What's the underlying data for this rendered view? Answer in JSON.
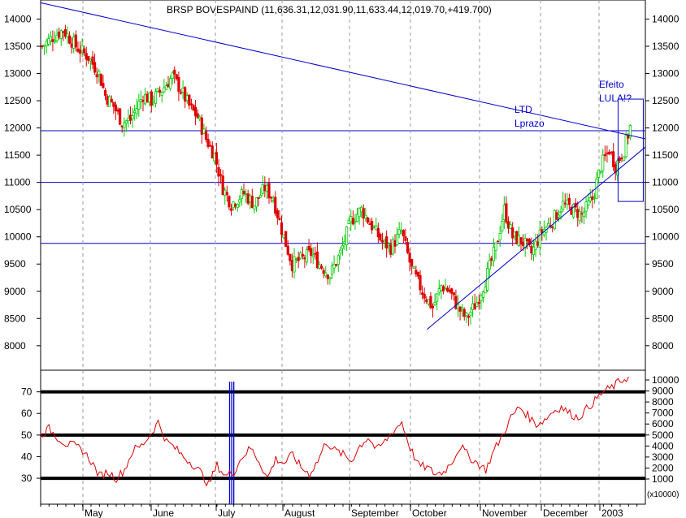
{
  "chart_data": [
    {
      "type": "candlestick",
      "title": "BRSP BOVESPAIND (11,636.31,12,031.90,11,633.44,12,019.70,+419.700)",
      "y_ticks": [
        8000,
        8500,
        9000,
        9500,
        10000,
        10500,
        11000,
        11500,
        12000,
        12500,
        13000,
        13500,
        14000
      ],
      "y_tick_labels": [
        "8000",
        "8500",
        "9000",
        "9500",
        "10000",
        "10500",
        "11000",
        "11500",
        "12000",
        "12500",
        "13000",
        "13500",
        "14000"
      ],
      "ylim": [
        7550,
        14350
      ],
      "x_month_labels": [
        "May",
        "June",
        "July",
        "August",
        "September",
        "October",
        "November",
        "December",
        "2003"
      ],
      "price_path": [
        [
          0,
          13500
        ],
        [
          6,
          13700
        ],
        [
          10,
          13800
        ],
        [
          16,
          13500
        ],
        [
          22,
          13300
        ],
        [
          27,
          13000
        ],
        [
          30,
          12600
        ],
        [
          34,
          12400
        ],
        [
          38,
          12100
        ],
        [
          42,
          12150
        ],
        [
          48,
          12600
        ],
        [
          52,
          12500
        ],
        [
          57,
          12700
        ],
        [
          62,
          12950
        ],
        [
          66,
          12700
        ],
        [
          70,
          12400
        ],
        [
          74,
          12200
        ],
        [
          78,
          11800
        ],
        [
          82,
          11500
        ],
        [
          86,
          10900
        ],
        [
          90,
          10600
        ],
        [
          96,
          10800
        ],
        [
          101,
          10600
        ],
        [
          106,
          10900
        ],
        [
          110,
          10700
        ],
        [
          115,
          10000
        ],
        [
          119,
          9500
        ],
        [
          124,
          9600
        ],
        [
          128,
          9700
        ],
        [
          132,
          9500
        ],
        [
          137,
          9300
        ],
        [
          142,
          9700
        ],
        [
          147,
          10300
        ],
        [
          152,
          10500
        ],
        [
          157,
          10200
        ],
        [
          162,
          9900
        ],
        [
          166,
          9800
        ],
        [
          171,
          10100
        ],
        [
          176,
          9400
        ],
        [
          181,
          9000
        ],
        [
          186,
          8700
        ],
        [
          190,
          9100
        ],
        [
          194,
          9000
        ],
        [
          198,
          8700
        ],
        [
          202,
          8500
        ],
        [
          207,
          8800
        ],
        [
          211,
          9200
        ],
        [
          216,
          9800
        ],
        [
          220,
          10500
        ],
        [
          224,
          10000
        ],
        [
          229,
          9900
        ],
        [
          233,
          9700
        ],
        [
          238,
          10100
        ],
        [
          243,
          10300
        ],
        [
          248,
          10600
        ],
        [
          253,
          10500
        ],
        [
          257,
          10400
        ],
        [
          262,
          10700
        ],
        [
          266,
          11300
        ],
        [
          270,
          11600
        ],
        [
          273,
          11300
        ],
        [
          277,
          11600
        ],
        [
          280,
          12019.7
        ]
      ],
      "highs_lows": [
        {
          "x": 0,
          "high": 13700,
          "low": 13350
        },
        {
          "x": 6,
          "high": 13900,
          "low": 13500
        },
        {
          "x": 10,
          "high": 13950,
          "low": 13600
        }
      ],
      "trend_lines": [
        {
          "label": "LTD Lprazo",
          "x1": 0,
          "y1": 14300,
          "x2": 288,
          "y2": 11800
        },
        {
          "label": "",
          "x1": 184,
          "y1": 8300,
          "x2": 288,
          "y2": 11650
        }
      ],
      "horizontal_lines": [
        11950,
        11000,
        9880
      ],
      "annotations": [
        {
          "text_lines": [
            "LTD",
            "Lprazo"
          ]
        },
        {
          "text_lines": [
            "Efeito",
            "LULA!?"
          ]
        }
      ],
      "box": {
        "x1": 275,
        "x2": 287,
        "y1": 10650,
        "y2": 12530
      }
    },
    {
      "type": "line",
      "name": "oscillator",
      "y_ticks_left": [
        30,
        40,
        50,
        60,
        70
      ],
      "y_tick_labels_left": [
        "30",
        "40",
        "50",
        "60",
        "70"
      ],
      "ylim_left": [
        18,
        80
      ],
      "y_ticks_right": [
        1000,
        2000,
        3000,
        4000,
        5000,
        6000,
        7000,
        8000,
        9000,
        10000
      ],
      "y_tick_labels_right": [
        "1000",
        "2000",
        "3000",
        "4000",
        "5000",
        "6000",
        "7000",
        "8000",
        "9000",
        "10000"
      ],
      "right_unit": "x10000",
      "reference_lines": [
        70,
        50,
        30
      ],
      "series": [
        {
          "x": [
            0,
            4,
            8,
            12,
            16,
            20,
            24,
            28,
            32,
            36,
            40,
            44,
            48,
            52,
            56,
            60,
            64,
            68,
            72,
            76,
            80,
            84,
            88,
            92,
            96,
            100,
            104,
            108,
            112,
            116,
            120,
            124,
            128,
            132,
            136,
            140,
            144,
            148,
            152,
            156,
            160,
            164,
            168,
            172,
            176,
            180,
            184,
            188,
            192,
            196,
            200,
            204,
            208,
            212,
            216,
            220,
            224,
            228,
            232,
            236,
            240,
            244,
            248,
            252,
            256,
            260,
            264,
            268,
            272,
            276,
            280
          ],
          "y": [
            50,
            53,
            49,
            46,
            45,
            43,
            38,
            31,
            33,
            30,
            34,
            43,
            45,
            50,
            56,
            47,
            44,
            40,
            37,
            33,
            27,
            36,
            31,
            33,
            40,
            44,
            38,
            30,
            39,
            37,
            41,
            35,
            32,
            38,
            47,
            43,
            41,
            38,
            45,
            49,
            43,
            47,
            52,
            56,
            44,
            36,
            35,
            32,
            33,
            38,
            45,
            40,
            37,
            34,
            43,
            50,
            58,
            63,
            59,
            55,
            57,
            61,
            63,
            60,
            58,
            62,
            66,
            70,
            72,
            75,
            77
          ]
        }
      ],
      "vertical_markers": [
        90,
        91,
        92
      ]
    }
  ]
}
